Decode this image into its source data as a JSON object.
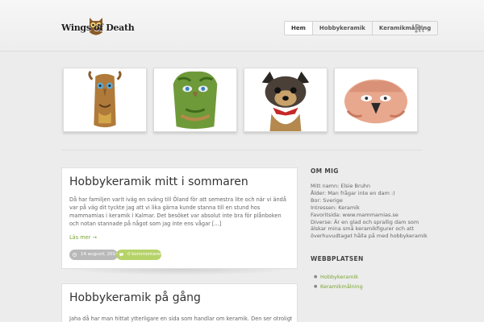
{
  "site": {
    "logo_text": "Wings of Death"
  },
  "nav": {
    "items": [
      "Hem",
      "Hobbykeramik",
      "Keramikmålning"
    ],
    "active_index": 0
  },
  "icons": {
    "rss": "rss-icon"
  },
  "gallery": {
    "items": [
      "tree-face-figurine",
      "green-tree-face-figurine",
      "yorkshire-terrier-figurine",
      "bird-figurine"
    ]
  },
  "posts": [
    {
      "title": "Hobbykeramik mitt i sommaren",
      "excerpt": "Då har familjen varit iväg en sväng till Öland för att semestra lite och när vi ändå var på väg dit tyckte jag att vi lika gärna kunde stanna till en stund hos mammamias i keramik i Kalmar. Det besöket var absolut inte bra för plånboken och notan stannade på något som jag inte ens vågar [...]",
      "read_more": "Läs mer →",
      "date": "14 augusti, 2014",
      "comments": "0 kommentarer"
    },
    {
      "title": "Hobbykeramik på gång",
      "excerpt": "Jaha då har man hittat ytterligare en sida som handlar om keramik. Den ser otroligt"
    }
  ],
  "sidebar": {
    "about_title": "OM MIG",
    "about_lines": [
      "Mitt namn: Elsie Bruhn",
      "Ålder: Man frågar inte en dam :)",
      "Bor: Sverige",
      "Intressen: Keramik",
      "Favoritsida: www.mammamias.se",
      "Diverse: Är en glad och sprallig dam som älskar mina små keramikfigurer och att överhuvudtaget hålla på med hobbykeramik"
    ],
    "links_title": "WEBBPLATSEN",
    "links": [
      "Hobbykeramik",
      "Keramikmålning"
    ]
  },
  "colors": {
    "accent": "#7aa52f",
    "comments_pill": "#b6d36a",
    "date_pill": "#b9b9b9"
  }
}
